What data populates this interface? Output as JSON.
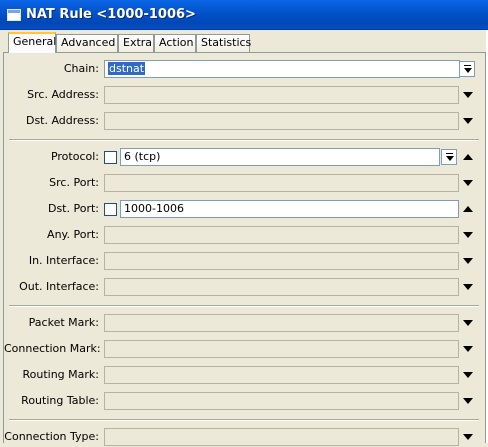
{
  "window": {
    "title": "NAT Rule <1000-1006>"
  },
  "tabs": [
    {
      "label": "General",
      "active": true
    },
    {
      "label": "Advanced",
      "active": false
    },
    {
      "label": "Extra",
      "active": false
    },
    {
      "label": "Action",
      "active": false
    },
    {
      "label": "Statistics",
      "active": false
    }
  ],
  "form": {
    "chain": {
      "label": "Chain:",
      "value": "dstnat"
    },
    "src_address": {
      "label": "Src. Address:",
      "value": ""
    },
    "dst_address": {
      "label": "Dst. Address:",
      "value": ""
    },
    "protocol": {
      "label": "Protocol:",
      "value": "6 (tcp)",
      "negate": false
    },
    "src_port": {
      "label": "Src. Port:",
      "value": ""
    },
    "dst_port": {
      "label": "Dst. Port:",
      "value": "1000-1006",
      "negate": false
    },
    "any_port": {
      "label": "Any. Port:",
      "value": ""
    },
    "in_interface": {
      "label": "In. Interface:",
      "value": ""
    },
    "out_interface": {
      "label": "Out. Interface:",
      "value": ""
    },
    "packet_mark": {
      "label": "Packet Mark:",
      "value": ""
    },
    "connection_mark": {
      "label": "Connection Mark:",
      "value": ""
    },
    "routing_mark": {
      "label": "Routing Mark:",
      "value": ""
    },
    "routing_table": {
      "label": "Routing Table:",
      "value": ""
    },
    "connection_type": {
      "label": "Connection Type:",
      "value": ""
    }
  },
  "icons": {
    "expand": "triangle-down-icon",
    "collapse": "triangle-up-icon",
    "dropdown": "dropdown-icon"
  }
}
